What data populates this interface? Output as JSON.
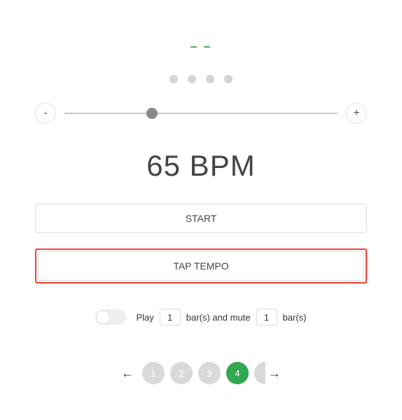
{
  "tempo_display": "– –",
  "slider": {
    "minus": "-",
    "plus": "+",
    "position_pct": 32
  },
  "bpm_label": "65 BPM",
  "start_button": "START",
  "tap_button": "TAP TEMPO",
  "mute": {
    "play_label": "Play",
    "bars1_label": "bar(s) and mute",
    "bars2_label": "bar(s)",
    "play_value": "1",
    "mute_value": "1"
  },
  "pager": {
    "prev": "←",
    "next": "→",
    "pages": [
      "1",
      "2",
      "3",
      "4"
    ],
    "active": "4"
  }
}
